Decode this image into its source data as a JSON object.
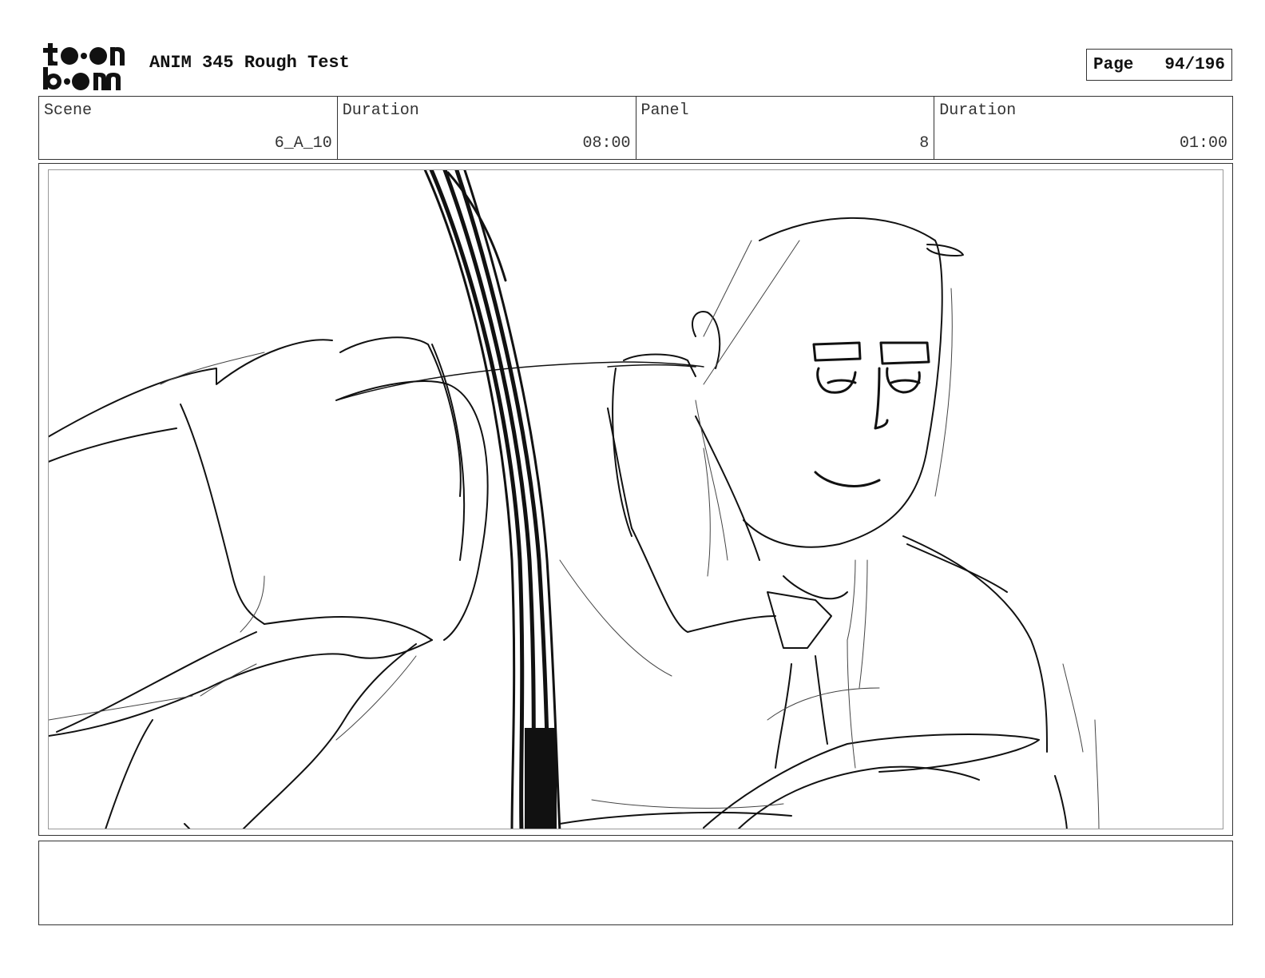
{
  "header": {
    "logo_text": "toon boom",
    "title": "ANIM 345 Rough Test",
    "page_label": "Page",
    "page_value": "94/196"
  },
  "info": {
    "scene_label": "Scene",
    "scene_value": "6_A_10",
    "scene_duration_label": "Duration",
    "scene_duration_value": "08:00",
    "panel_label": "Panel",
    "panel_value": "8",
    "panel_duration_label": "Duration",
    "panel_duration_value": "01:00"
  },
  "notes": {
    "text": ""
  }
}
